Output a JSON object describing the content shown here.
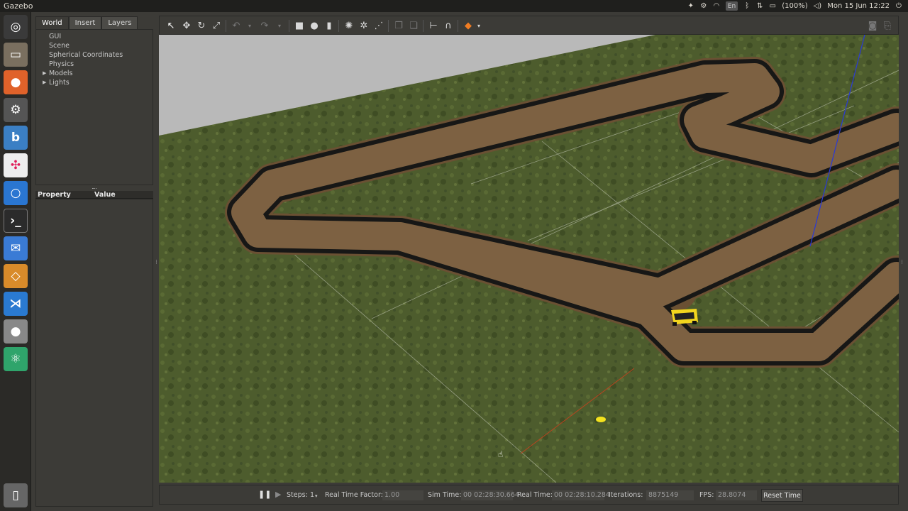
{
  "app": {
    "title": "Gazebo"
  },
  "tray": {
    "percent": "(100%)",
    "datetime": "Mon 15 Jun 12:22",
    "lang": "En"
  },
  "tabs": [
    "World",
    "Insert",
    "Layers"
  ],
  "world_tree": {
    "items": [
      "GUI",
      "Scene",
      "Spherical Coordinates",
      "Physics",
      "Models",
      "Lights"
    ]
  },
  "properties": {
    "col_property": "Property",
    "col_value": "Value"
  },
  "bottom": {
    "steps_label": "Steps:",
    "steps_value": "1",
    "rtf_label": "Real Time Factor:",
    "rtf_value": "1.00",
    "sim_label": "Sim Time:",
    "sim_value": "00 02:28:30.664",
    "real_label": "Real Time:",
    "real_value": "00 02:28:10.284",
    "iter_label": "Iterations:",
    "iter_value": "8875149",
    "fps_label": "FPS:",
    "fps_value": "28.8074",
    "reset_label": "Reset Time"
  },
  "colors": {
    "panel": "#3c3b37",
    "ground": "#4a5a2c",
    "track": "#6b5236",
    "border": "#1a1a1a",
    "sky": "#b8b8b8"
  },
  "launcher_icons": [
    "ubuntu-dash-icon",
    "files-icon",
    "firefox-icon",
    "settings-icon",
    "ide-icon",
    "slack-icon",
    "signal-icon",
    "terminal-icon",
    "mail-icon",
    "gazebo-icon",
    "vscode-icon",
    "disk-icon",
    "atom-icon",
    "trash-icon"
  ]
}
